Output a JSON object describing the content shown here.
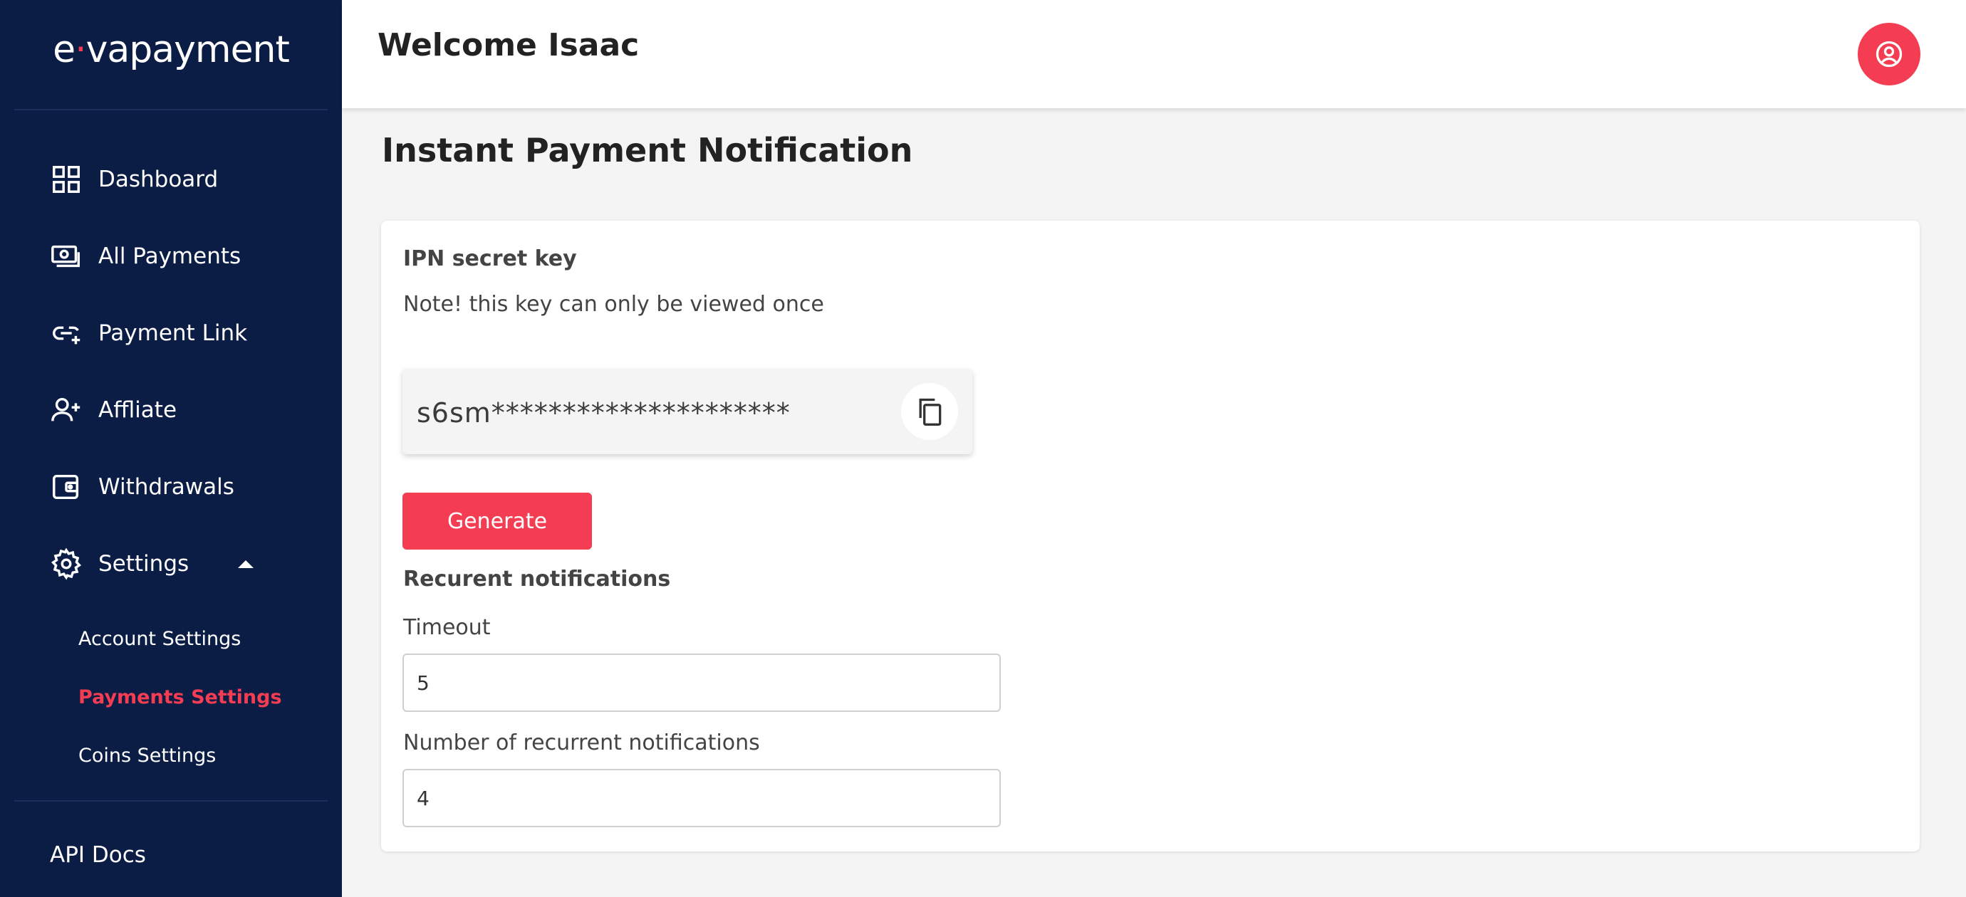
{
  "brand": {
    "logo_prefix": "e",
    "logo_accent": "·",
    "logo_rest": "vapayment",
    "accent_color": "#f43d52",
    "sidebar_color": "#0b1d45"
  },
  "sidebar": {
    "items": [
      {
        "label": "Dashboard",
        "icon": "grid-icon"
      },
      {
        "label": "All Payments",
        "icon": "cash-icon"
      },
      {
        "label": "Payment Link",
        "icon": "link-add-icon"
      },
      {
        "label": "Affliate",
        "icon": "user-plus-icon"
      },
      {
        "label": "Withdrawals",
        "icon": "wallet-icon"
      },
      {
        "label": "Settings",
        "icon": "gear-icon"
      }
    ],
    "settings_sub": [
      {
        "label": "Account Settings",
        "active": false
      },
      {
        "label": "Payments Settings",
        "active": true
      },
      {
        "label": "Coins Settings",
        "active": false
      }
    ],
    "api_docs": "API Docs"
  },
  "header": {
    "welcome": "Welcome Isaac",
    "avatar_icon": "user-circle-icon"
  },
  "main": {
    "title": "Instant Payment Notification",
    "ipn": {
      "heading": "IPN secret key",
      "note": "Note! this key can only be viewed once",
      "key_prefix": "s6sm",
      "key_mask": "*********************",
      "copy_icon": "copy-icon",
      "generate_label": "Generate"
    },
    "recurrent": {
      "heading": "Recurent notifications",
      "timeout_label": "Timeout",
      "timeout_value": "5",
      "count_label": "Number of recurrent notifications",
      "count_value": "4"
    }
  }
}
